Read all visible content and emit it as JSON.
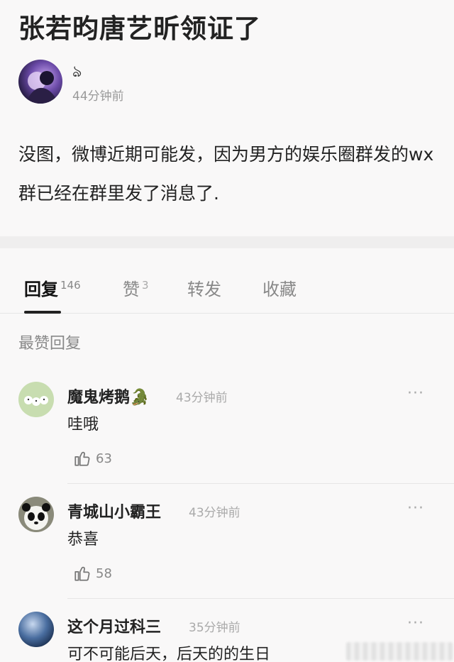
{
  "post": {
    "title": "张若昀唐艺昕领证了",
    "author": "ঌ",
    "time": "44分钟前",
    "body": "没图，微博近期可能发，因为男方的娱乐圈群发的wx群已经在群里发了消息了."
  },
  "tabs": [
    {
      "label": "回复",
      "count": "146",
      "active": true
    },
    {
      "label": "赞",
      "count": "3",
      "active": false
    },
    {
      "label": "转发",
      "count": "",
      "active": false
    },
    {
      "label": "收藏",
      "count": "",
      "active": false
    }
  ],
  "section_label": "最赞回复",
  "comments": [
    {
      "name": "魔鬼烤鹅🐊",
      "time": "43分钟前",
      "text": "哇哦",
      "likes": "63"
    },
    {
      "name": "青城山小霸王",
      "time": "43分钟前",
      "text": "恭喜",
      "likes": "58"
    },
    {
      "name": "这个月过科三",
      "time": "35分钟前",
      "text": "可不可能后天，后天的的生日",
      "likes": ""
    }
  ],
  "icons": {
    "more": "···",
    "like": "thumbs-up-icon"
  },
  "colors": {
    "background": "#f9f8f8",
    "muted_text": "#9a9a9a",
    "divider": "#e6e6e6"
  }
}
